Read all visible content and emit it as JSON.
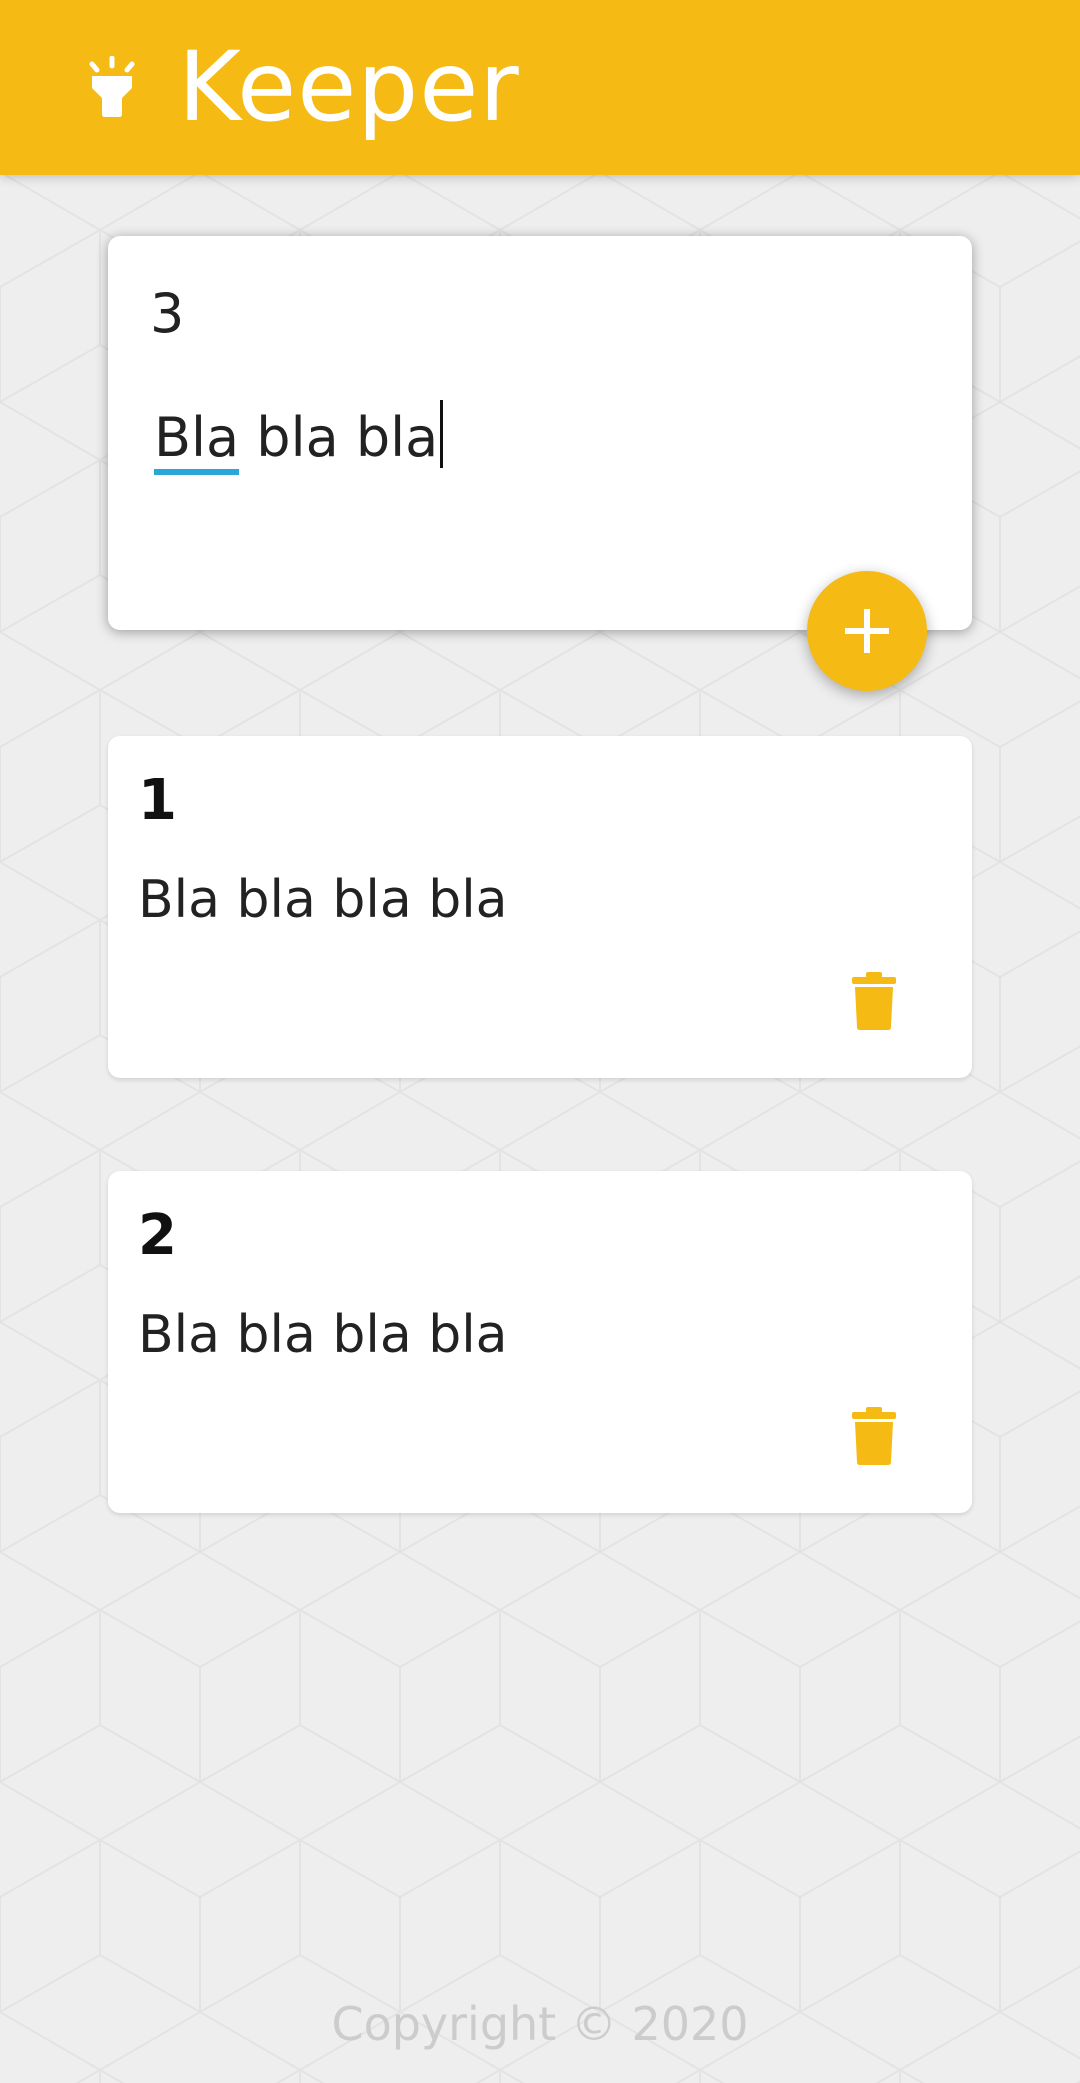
{
  "header": {
    "title": "Keeper",
    "logo_icon": "lamp-icon",
    "color": "#f5ba13"
  },
  "compose": {
    "title_value": "3",
    "content_value": "Bla bla bla",
    "spell_word": "Bla",
    "rest_text": " bla bla",
    "add_icon": "plus-icon"
  },
  "notes": [
    {
      "title": "1",
      "content": "Bla bla bla bla",
      "delete_icon": "trash-icon"
    },
    {
      "title": "2",
      "content": "Bla bla bla bla",
      "delete_icon": "trash-icon"
    }
  ],
  "footer": {
    "text": "Copyright © 2020"
  },
  "colors": {
    "accent": "#f5ba13",
    "spellcheck_underline": "#2aa7d8",
    "background": "#eeeeee"
  }
}
